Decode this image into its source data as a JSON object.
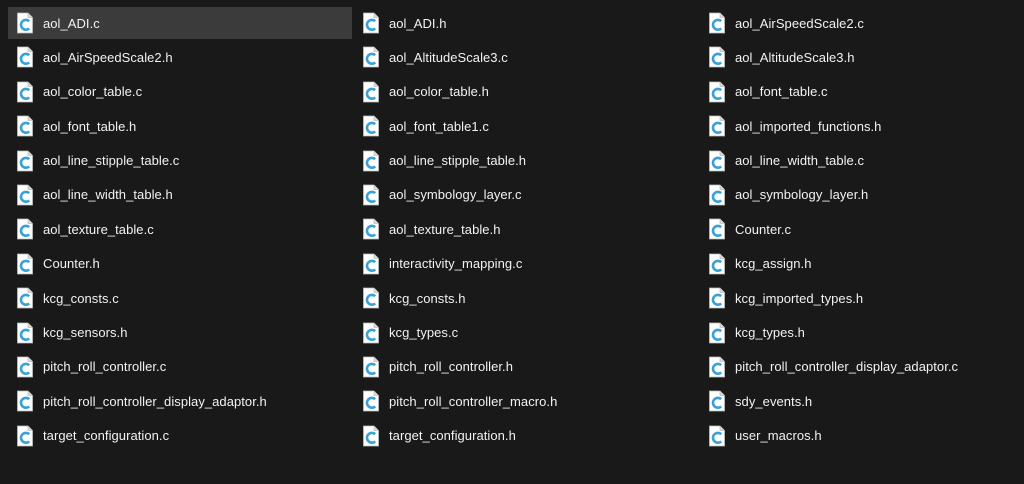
{
  "icon": "c-source-file-icon",
  "colors": {
    "background": "#191919",
    "selected_background": "#3b3b3b",
    "icon_page": "#ffffff",
    "icon_letter": "#3aa0d8",
    "text": "#f2f2f2"
  },
  "selected_index": 0,
  "files": [
    "aol_ADI.c",
    "aol_ADI.h",
    "aol_AirSpeedScale2.c",
    "aol_AirSpeedScale2.h",
    "aol_AltitudeScale3.c",
    "aol_AltitudeScale3.h",
    "aol_color_table.c",
    "aol_color_table.h",
    "aol_font_table.c",
    "aol_font_table.h",
    "aol_font_table1.c",
    "aol_imported_functions.h",
    "aol_line_stipple_table.c",
    "aol_line_stipple_table.h",
    "aol_line_width_table.c",
    "aol_line_width_table.h",
    "aol_symbology_layer.c",
    "aol_symbology_layer.h",
    "aol_texture_table.c",
    "aol_texture_table.h",
    "Counter.c",
    "Counter.h",
    "interactivity_mapping.c",
    "kcg_assign.h",
    "kcg_consts.c",
    "kcg_consts.h",
    "kcg_imported_types.h",
    "kcg_sensors.h",
    "kcg_types.c",
    "kcg_types.h",
    "pitch_roll_controller.c",
    "pitch_roll_controller.h",
    "pitch_roll_controller_display_adaptor.c",
    "pitch_roll_controller_display_adaptor.h",
    "pitch_roll_controller_macro.h",
    "sdy_events.h",
    "target_configuration.c",
    "target_configuration.h",
    "user_macros.h"
  ]
}
